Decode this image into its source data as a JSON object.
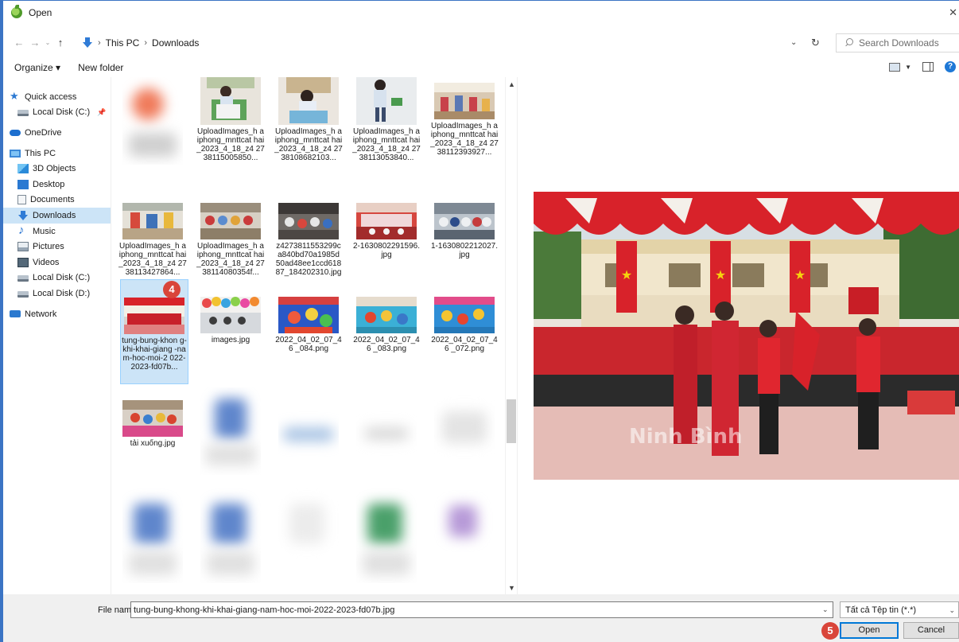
{
  "window": {
    "title": "Open"
  },
  "address": {
    "crumbs": [
      "This PC",
      "Downloads"
    ],
    "search_placeholder": "Search Downloads"
  },
  "toolbar": {
    "organize": "Organize ▾",
    "new_folder": "New folder"
  },
  "sidebar": {
    "items": [
      {
        "label": "Quick access",
        "icon": "star-icon"
      },
      {
        "label": "Local Disk (C:)",
        "icon": "disk-icon"
      },
      {
        "label": "OneDrive",
        "icon": "cloud-icon"
      },
      {
        "label": "This PC",
        "icon": "computer-icon"
      },
      {
        "label": "3D Objects",
        "icon": "cube-icon"
      },
      {
        "label": "Desktop",
        "icon": "desktop-icon"
      },
      {
        "label": "Documents",
        "icon": "document-icon"
      },
      {
        "label": "Downloads",
        "icon": "download-icon"
      },
      {
        "label": "Music",
        "icon": "music-icon"
      },
      {
        "label": "Pictures",
        "icon": "pictures-icon"
      },
      {
        "label": "Videos",
        "icon": "video-icon"
      },
      {
        "label": "Local Disk (C:)",
        "icon": "disk-icon"
      },
      {
        "label": "Local Disk (D:)",
        "icon": "disk-icon"
      },
      {
        "label": "Network",
        "icon": "network-icon"
      }
    ]
  },
  "files": [
    {
      "name": "UploadImages_haiphong_mnttcathai_2023_4_18_z42738115005850...",
      "display": "UploadImages_h aiphong_mnttcat hai_2023_4_18_z4 2738115005850..."
    },
    {
      "name": "UploadImages_haiphong_mnttcathai_2023_4_18_z42738108682103...",
      "display": "UploadImages_h aiphong_mnttcat hai_2023_4_18_z4 2738108682103..."
    },
    {
      "name": "UploadImages_haiphong_mnttcathai_2023_4_18_z42738113053840...",
      "display": "UploadImages_h aiphong_mnttcat hai_2023_4_18_z4 2738113053840..."
    },
    {
      "name": "UploadImages_haiphong_mnttcathai_2023_4_18_z42738112393927...",
      "display": "UploadImages_h aiphong_mnttcat hai_2023_4_18_z4 2738112393927..."
    },
    {
      "name": "UploadImages_haiphong_mnttcathai_2023_4_18_z42738113427864...",
      "display": "UploadImages_h aiphong_mnttcat hai_2023_4_18_z4 2738113427864..."
    },
    {
      "name": "UploadImages_haiphong_mnttcathai_2023_4_18_z42738114080354f...",
      "display": "UploadImages_h aiphong_mnttcat hai_2023_4_18_z4 2738114080354f..."
    },
    {
      "name": "z4273811553299ca840bd70a1985d50ad48ee1ccd61887_184202310.jpg",
      "display": "z4273811553299c a840bd70a1985d 50ad48ee1ccd618 87_184202310.jpg"
    },
    {
      "name": "2-1630802291596.jpg",
      "display": "2-1630802291596. jpg"
    },
    {
      "name": "1-1630802212027.jpg",
      "display": "1-1630802212027. jpg"
    },
    {
      "name": "tung-bung-khong-khi-khai-giang-nam-hoc-moi-2022-2023-fd07b...",
      "display": "tung-bung-khon g-khi-khai-giang -nam-hoc-moi-2 022-2023-fd07b..."
    },
    {
      "name": "images.jpg",
      "display": "images.jpg"
    },
    {
      "name": "2022_04_02_07_46_084.png",
      "display": "2022_04_02_07_46 _084.png"
    },
    {
      "name": "2022_04_02_07_46_083.png",
      "display": "2022_04_02_07_46 _083.png"
    },
    {
      "name": "2022_04_02_07_46_072.png",
      "display": "2022_04_02_07_46 _072.png"
    },
    {
      "name": "tải xuống.jpg",
      "display": "tải xuống.jpg"
    }
  ],
  "annotations": {
    "step_select": "4",
    "step_open": "5"
  },
  "preview": {
    "watermark": "Ninh Bình"
  },
  "bottom": {
    "file_name_label": "File name:",
    "file_name_value": "tung-bung-khong-khi-khai-giang-nam-hoc-moi-2022-2023-fd07b.jpg",
    "file_type": "Tất cả Tệp tin (*.*)",
    "open_label": "Open",
    "cancel_label": "Cancel"
  },
  "colors": {
    "accent": "#0078d7",
    "selection": "#cce4f7",
    "badge": "#d9453a",
    "flag_red": "#d8222a"
  }
}
